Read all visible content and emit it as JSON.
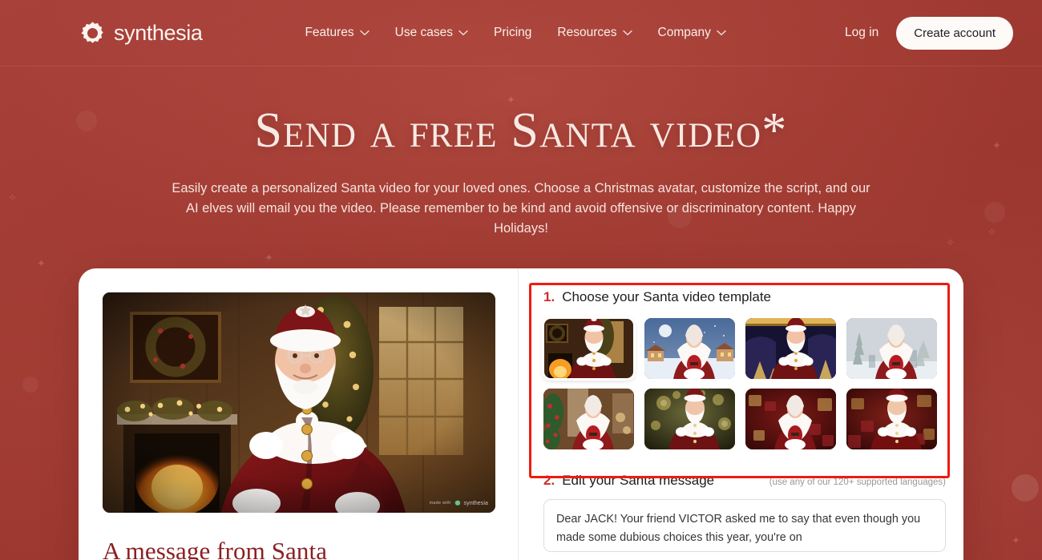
{
  "header": {
    "brand": {
      "name": "synthesia",
      "icon": "synthesia-logo-icon"
    },
    "nav": [
      {
        "label": "Features",
        "has_dropdown": true
      },
      {
        "label": "Use cases",
        "has_dropdown": true
      },
      {
        "label": "Pricing",
        "has_dropdown": false
      },
      {
        "label": "Resources",
        "has_dropdown": true
      },
      {
        "label": "Company",
        "has_dropdown": true
      }
    ],
    "login_label": "Log in",
    "cta_label": "Create account"
  },
  "hero": {
    "title": "Send a free Santa video*",
    "subtitle": "Easily create a personalized Santa video for your loved ones. Choose a Christmas avatar, customize the script, and our AI elves will email you the video. Please remember to be kind and avoid offensive or discriminatory content. Happy Holidays!"
  },
  "preview": {
    "heading": "A message from Santa",
    "watermark_prefix": "made with",
    "watermark_brand": "synthesia"
  },
  "steps": {
    "one": {
      "number": "1.",
      "title": "Choose your Santa video template",
      "templates": [
        {
          "name": "santa-fireplace-study",
          "selected": true
        },
        {
          "name": "mrs-claus-snowy-village",
          "selected": false
        },
        {
          "name": "santa-golden-stage",
          "selected": false
        },
        {
          "name": "mrs-claus-snowy-trees",
          "selected": false
        },
        {
          "name": "mrs-claus-toy-workshop",
          "selected": false
        },
        {
          "name": "santa-bokeh-lights",
          "selected": false
        },
        {
          "name": "mrs-claus-red-gifts",
          "selected": false
        },
        {
          "name": "santa-red-gifts",
          "selected": false
        }
      ]
    },
    "two": {
      "number": "2.",
      "title": "Edit your Santa message",
      "hint": "(use any of our 120+ supported languages)",
      "message_value": "Dear JACK! Your friend VICTOR asked me to say that even though you made some dubious choices this year, you're on"
    }
  },
  "colors": {
    "page_background": "#a03a32",
    "card_background": "#ffffff",
    "accent_red": "#c9302c",
    "annotation_red": "#ee1b11",
    "heading_serif": "#8c1f22",
    "hero_text": "#f7e9e3"
  }
}
